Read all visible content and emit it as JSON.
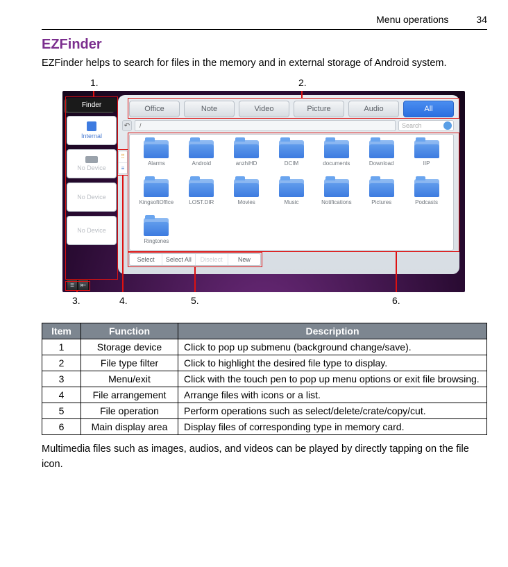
{
  "header": {
    "section": "Menu operations",
    "page": "34"
  },
  "title": "EZFinder",
  "intro": "EZFinder helps to search for files in the memory and in external storage of Android system.",
  "callouts_top": {
    "c1": "1.",
    "c2": "2."
  },
  "callouts_bot": {
    "c3": "3.",
    "c4": "4.",
    "c5": "5.",
    "c6": "6."
  },
  "sidebar": {
    "tab": "Finder",
    "dev1": "Internal",
    "dev2": "No Device",
    "dev3": "No Device",
    "dev4": "No Device"
  },
  "filters": [
    "Office",
    "Note",
    "Video",
    "Picture",
    "Audio",
    "All"
  ],
  "path": "/",
  "search_placeholder": "Search",
  "folders": [
    "Alarms",
    "Android",
    "anzhiHD",
    "DCIM",
    "documents",
    "Download",
    "IIP",
    "KingsoftOffice",
    "LOST.DIR",
    "Movies",
    "Music",
    "Notifications",
    "Pictures",
    "Podcasts",
    "Ringtones"
  ],
  "ops": [
    "Select",
    "Select All",
    "Diselect",
    "New"
  ],
  "table": {
    "headers": [
      "Item",
      "Function",
      "Description"
    ],
    "rows": [
      {
        "n": "1",
        "f": "Storage device",
        "d": "Click to pop up submenu (background change/save)."
      },
      {
        "n": "2",
        "f": "File type filter",
        "d": "Click to highlight the desired file type to display."
      },
      {
        "n": "3",
        "f": "Menu/exit",
        "d": "Click with the touch pen to pop up menu options or exit file browsing."
      },
      {
        "n": "4",
        "f": "File arrangement",
        "d": "Arrange files with icons or a list."
      },
      {
        "n": "5",
        "f": "File operation",
        "d": "Perform operations such as select/delete/crate/copy/cut."
      },
      {
        "n": "6",
        "f": "Main display area",
        "d": "Display files of corresponding type in memory card."
      }
    ]
  },
  "outro": "Multimedia files such as images, audios, and videos can be played by directly tapping on the file icon."
}
